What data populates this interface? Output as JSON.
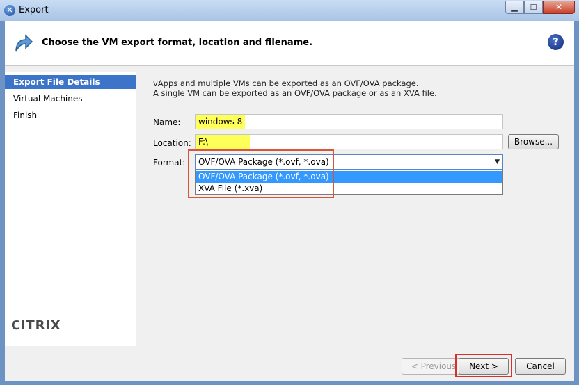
{
  "window": {
    "title": "Export",
    "icons": {
      "app": "close-circle-icon",
      "minimize": "minimize-icon",
      "maximize": "maximize-icon",
      "close": "close-icon"
    }
  },
  "header": {
    "title": "Choose the VM export format, location and filename.",
    "help_label": "?"
  },
  "sidebar": {
    "items": [
      {
        "label": "Export File Details",
        "selected": true
      },
      {
        "label": "Virtual Machines",
        "selected": false
      },
      {
        "label": "Finish",
        "selected": false
      }
    ],
    "logo": "CiTRiX"
  },
  "content": {
    "intro_line1": "vApps and multiple VMs can be exported as an OVF/OVA package.",
    "intro_line2": "A single VM can be exported as an OVF/OVA package or as an XVA file.",
    "name_label": "Name:",
    "name_value": "windows 8",
    "location_label": "Location:",
    "location_value": "F:\\",
    "browse_label": "Browse...",
    "format_label": "Format:",
    "format_selected": "OVF/OVA Package (*.ovf, *.ova)",
    "format_options": [
      {
        "label": "OVF/OVA Package (*.ovf, *.ova)",
        "highlighted": true
      },
      {
        "label": "XVA File (*.xva)",
        "highlighted": false
      }
    ]
  },
  "footer": {
    "previous_label": "< Previous",
    "next_label": "Next >",
    "cancel_label": "Cancel"
  },
  "colors": {
    "selection": "#3b74c8",
    "highlight_yellow": "#ffff5a",
    "callout_red": "#d9543a"
  }
}
